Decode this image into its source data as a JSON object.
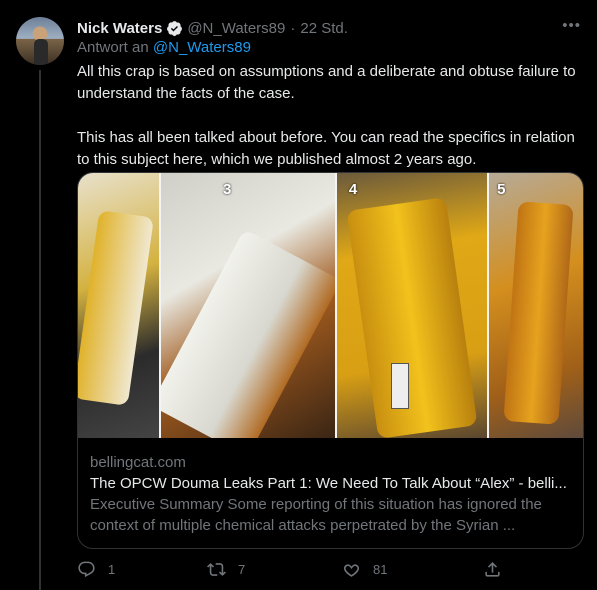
{
  "tweet": {
    "author_name": "Nick Waters",
    "author_handle": "@N_Waters89",
    "separator": "·",
    "time": "22 Std.",
    "reply_prefix": "Antwort an",
    "reply_handle": "@N_Waters89",
    "paragraphs": [
      "All this crap is based on assumptions and a deliberate and obtuse failure to understand the facts of the case.",
      "This has all been talked about before. You can read the specifics in relation to this subject here, which we published almost 2 years ago."
    ]
  },
  "card": {
    "photo_numbers": [
      "3",
      "4",
      "5"
    ],
    "domain": "bellingcat.com",
    "title": "The OPCW Douma Leaks Part 1: We Need To Talk About “Alex” - belli...",
    "description": "Executive Summary Some reporting of this situation has ignored the context of multiple chemical attacks perpetrated by the Syrian ..."
  },
  "actions": {
    "reply_count": "1",
    "retweet_count": "7",
    "like_count": "81",
    "icons": [
      "reply-icon",
      "retweet-icon",
      "like-icon",
      "share-icon"
    ]
  },
  "colors": {
    "accent": "#1d9bf0",
    "background": "#000000",
    "muted": "#71767b"
  }
}
